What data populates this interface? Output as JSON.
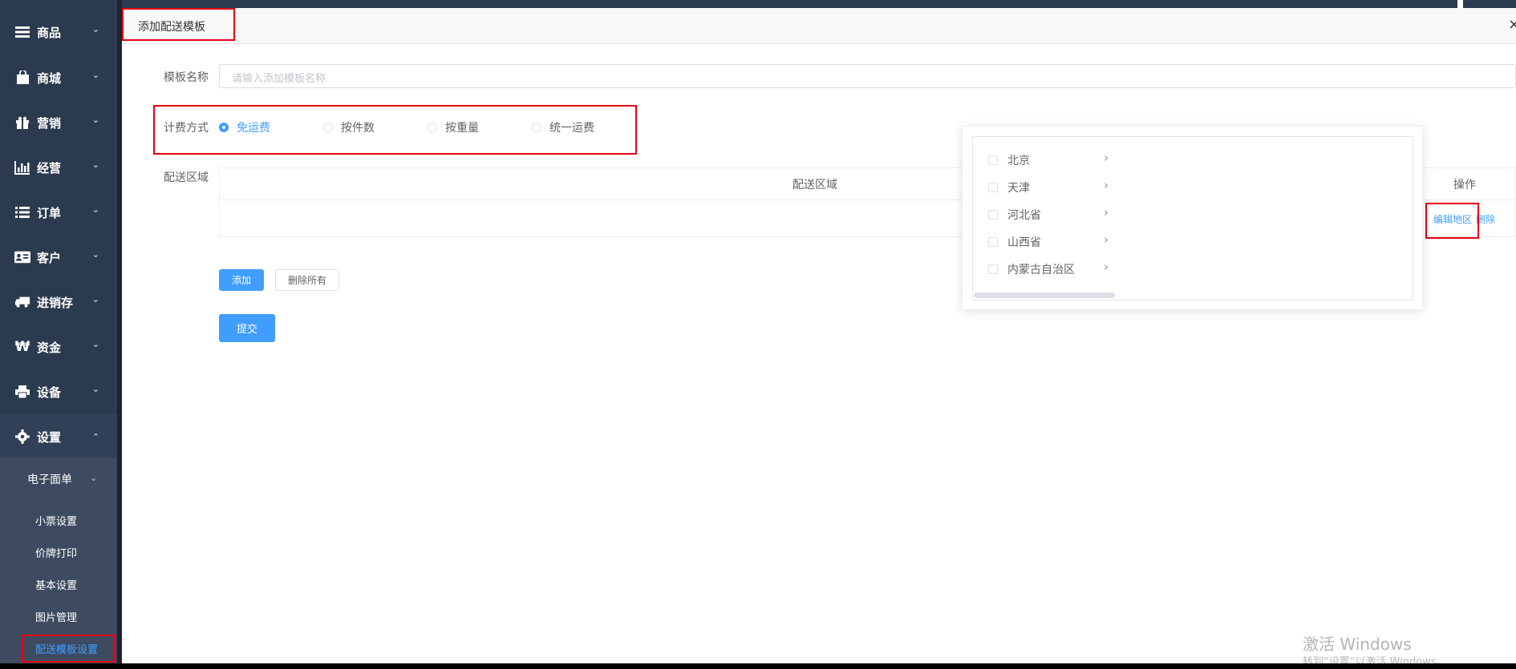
{
  "sidebar": {
    "items": [
      {
        "label": "商品",
        "icon": "menu-icon"
      },
      {
        "label": "商城",
        "icon": "shopping-bag-icon"
      },
      {
        "label": "营销",
        "icon": "gift-icon"
      },
      {
        "label": "经营",
        "icon": "bar-chart-icon"
      },
      {
        "label": "订单",
        "icon": "list-icon"
      },
      {
        "label": "客户",
        "icon": "id-card-icon"
      },
      {
        "label": "进销存",
        "icon": "truck-icon"
      },
      {
        "label": "资金",
        "icon": "won-icon"
      },
      {
        "label": "设备",
        "icon": "printer-icon"
      },
      {
        "label": "设置",
        "icon": "gear-icon"
      }
    ],
    "submenu_title": "电子面单",
    "subitems": [
      "小票设置",
      "价牌打印",
      "基本设置",
      "图片管理",
      "配送模板设置"
    ]
  },
  "dialog": {
    "title": "添加配送模板",
    "close": "×",
    "template_name_label": "模板名称",
    "template_name_placeholder": "请输入添加模板名称",
    "billing_label": "计费方式",
    "billing_options": [
      "免运费",
      "按件数",
      "按重量",
      "统一运费"
    ],
    "billing_selected": "免运费",
    "area_label": "配送区域",
    "table": {
      "col_area": "配送区域",
      "col_action": "操作",
      "edit_link": "编辑地区",
      "delete_link": "删除"
    },
    "add_button": "添加",
    "delete_all_button": "删除所有",
    "submit_button": "提交"
  },
  "region_picker": {
    "regions": [
      "北京",
      "天津",
      "河北省",
      "山西省",
      "内蒙古自治区"
    ]
  },
  "watermark": {
    "line1": "激活 Windows",
    "line2": "转到“设置”以激活 Windows。"
  },
  "colors": {
    "sidebar_bg": "#2c3a4f",
    "accent": "#409eff",
    "highlight_border": "#e60012"
  }
}
